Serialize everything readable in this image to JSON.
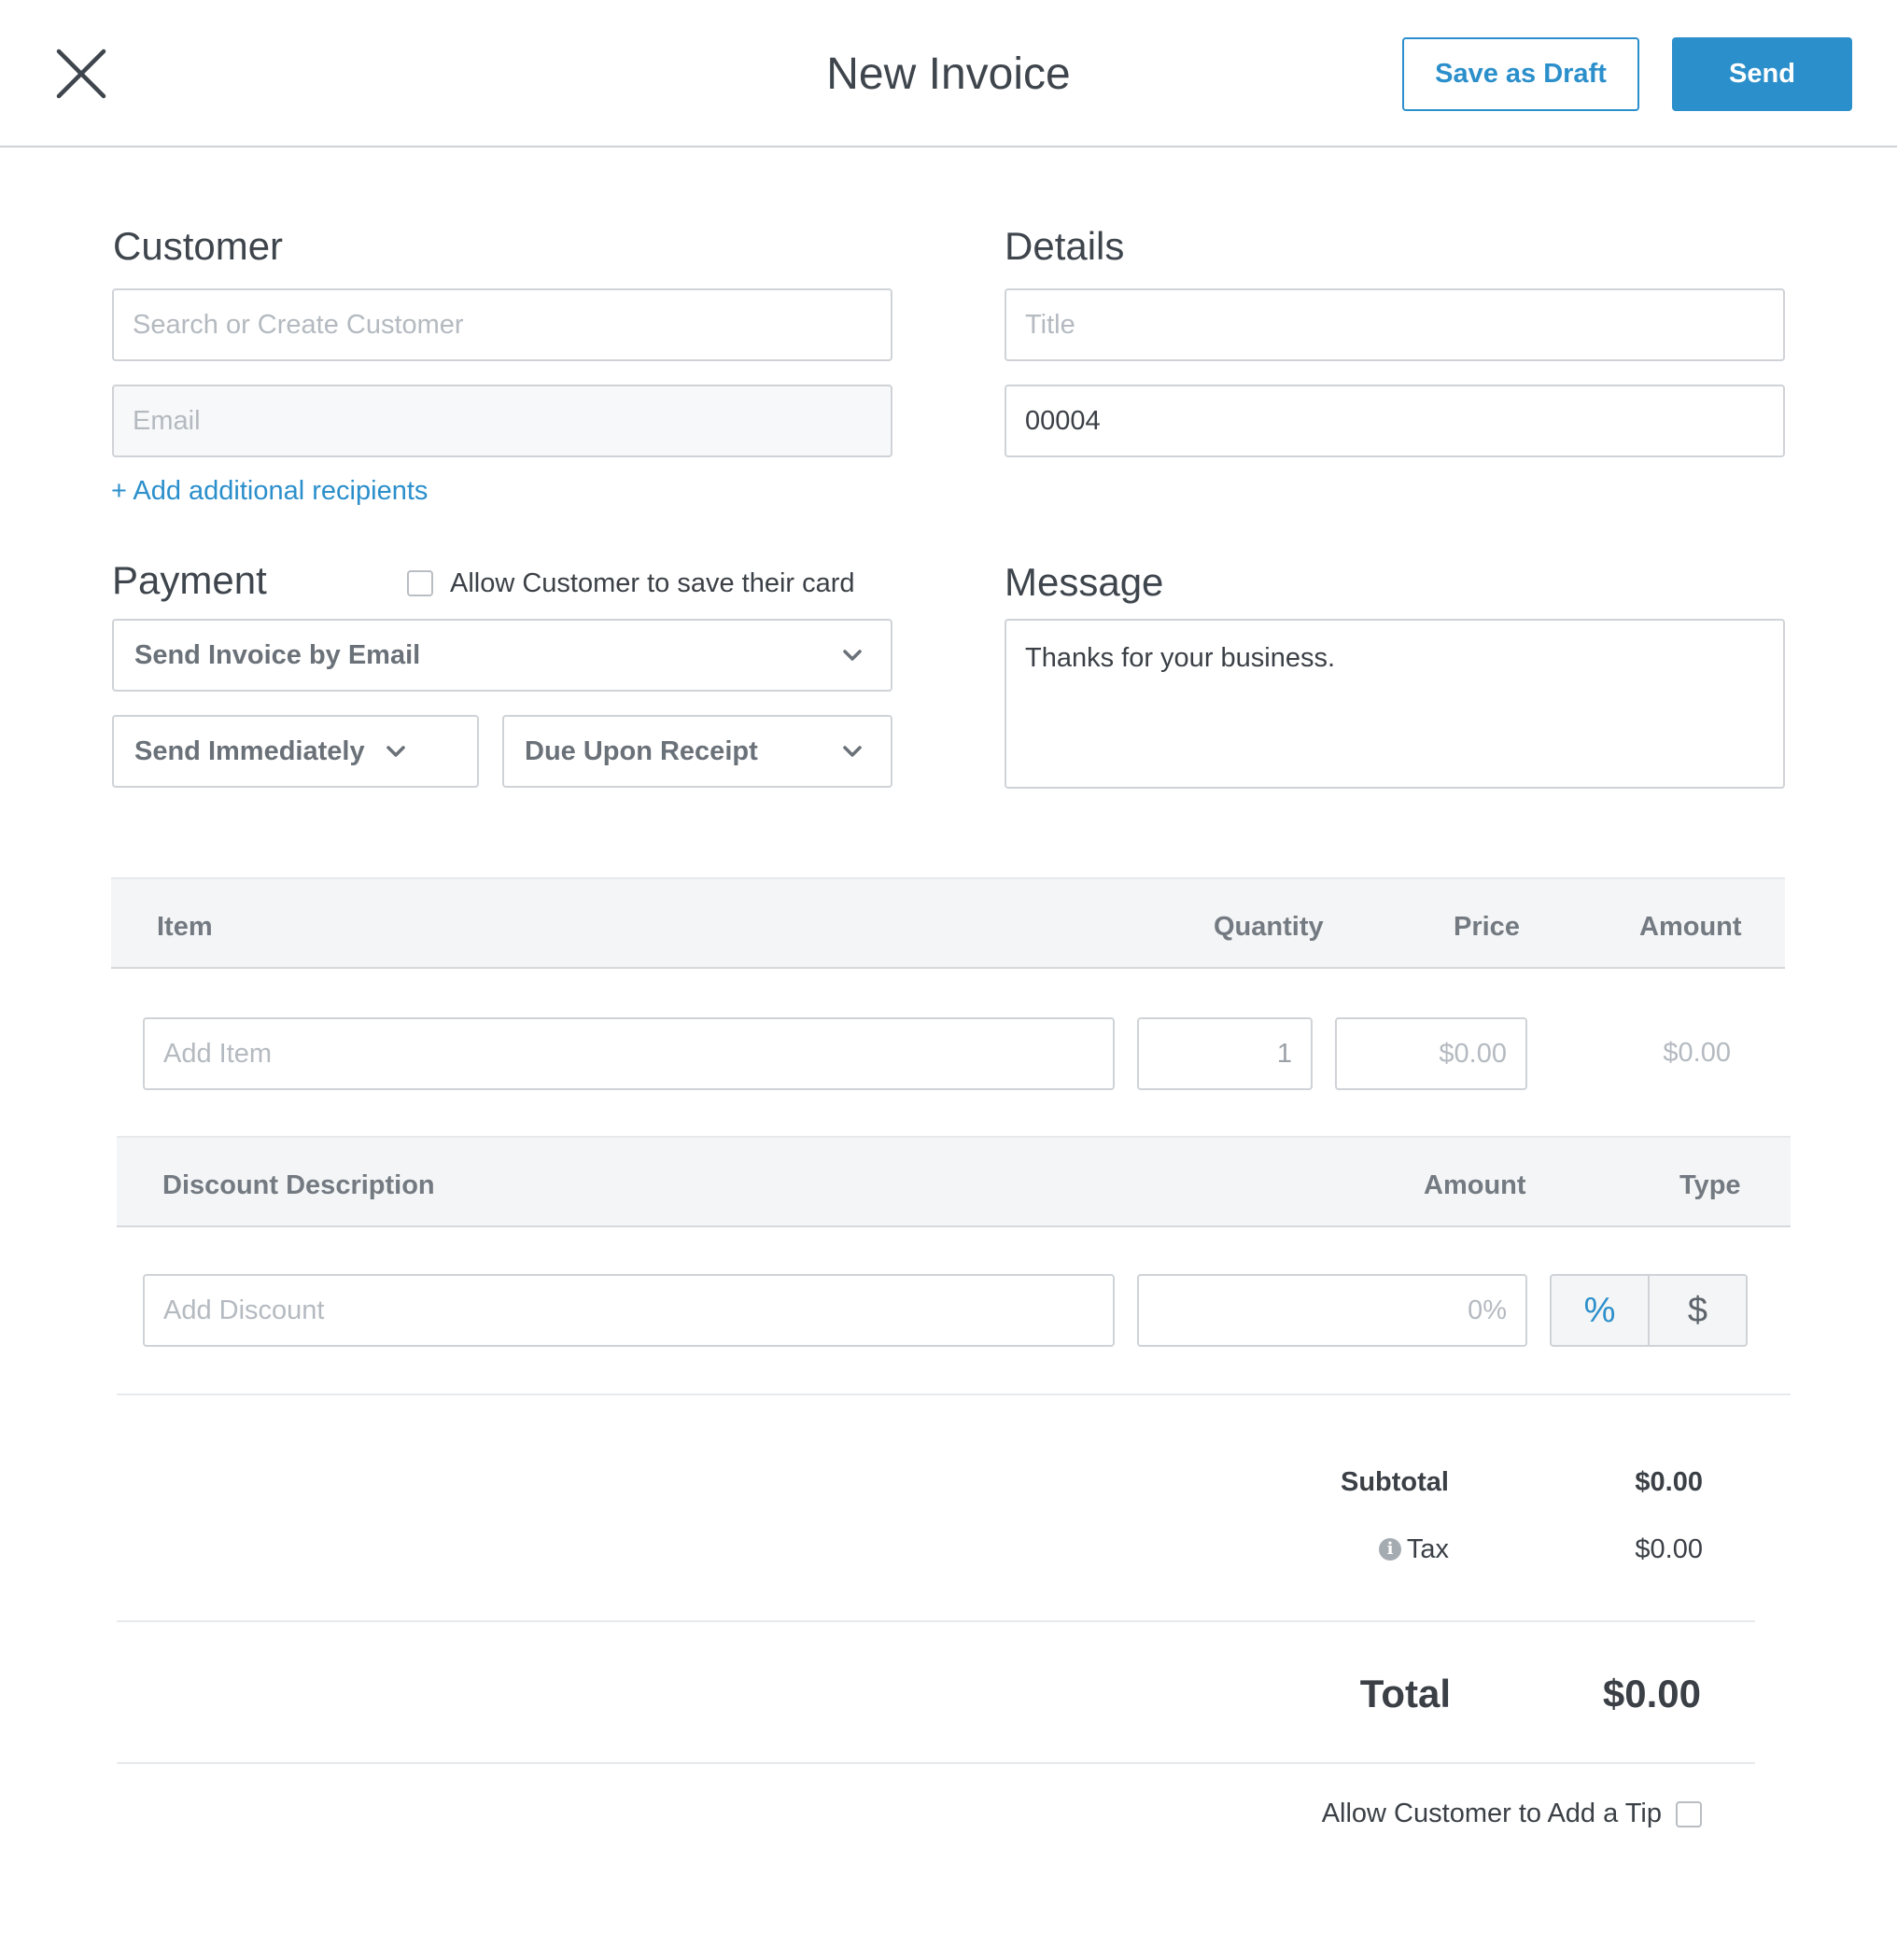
{
  "header": {
    "title": "New Invoice",
    "save_draft_label": "Save as Draft",
    "send_label": "Send",
    "close_icon": "close-icon"
  },
  "customer": {
    "heading": "Customer",
    "search_placeholder": "Search or Create Customer",
    "email_placeholder": "Email",
    "add_recipients_link": "+ Add additional recipients"
  },
  "details": {
    "heading": "Details",
    "title_placeholder": "Title",
    "invoice_number": "00004"
  },
  "payment": {
    "heading": "Payment",
    "save_card_label": "Allow Customer to save their card",
    "delivery_method": "Send Invoice by Email",
    "send_timing": "Send Immediately",
    "due_terms": "Due Upon Receipt"
  },
  "message": {
    "heading": "Message",
    "text": "Thanks for your business."
  },
  "items": {
    "columns": {
      "item": "Item",
      "quantity": "Quantity",
      "price": "Price",
      "amount": "Amount"
    },
    "item_placeholder": "Add Item",
    "quantity_value": "1",
    "price_placeholder": "$0.00",
    "amount_value": "$0.00"
  },
  "discount": {
    "columns": {
      "description": "Discount Description",
      "amount": "Amount",
      "type": "Type"
    },
    "description_placeholder": "Add Discount",
    "amount_placeholder": "0%",
    "type_percent": "%",
    "type_dollar": "$"
  },
  "totals": {
    "subtotal_label": "Subtotal",
    "subtotal_value": "$0.00",
    "tax_label": "Tax",
    "tax_value": "$0.00",
    "total_label": "Total",
    "total_value": "$0.00"
  },
  "tip": {
    "label": "Allow Customer to Add a Tip"
  },
  "colors": {
    "accent": "#2b8fcb",
    "border": "#cfd3d7",
    "band": "#f4f5f6"
  }
}
